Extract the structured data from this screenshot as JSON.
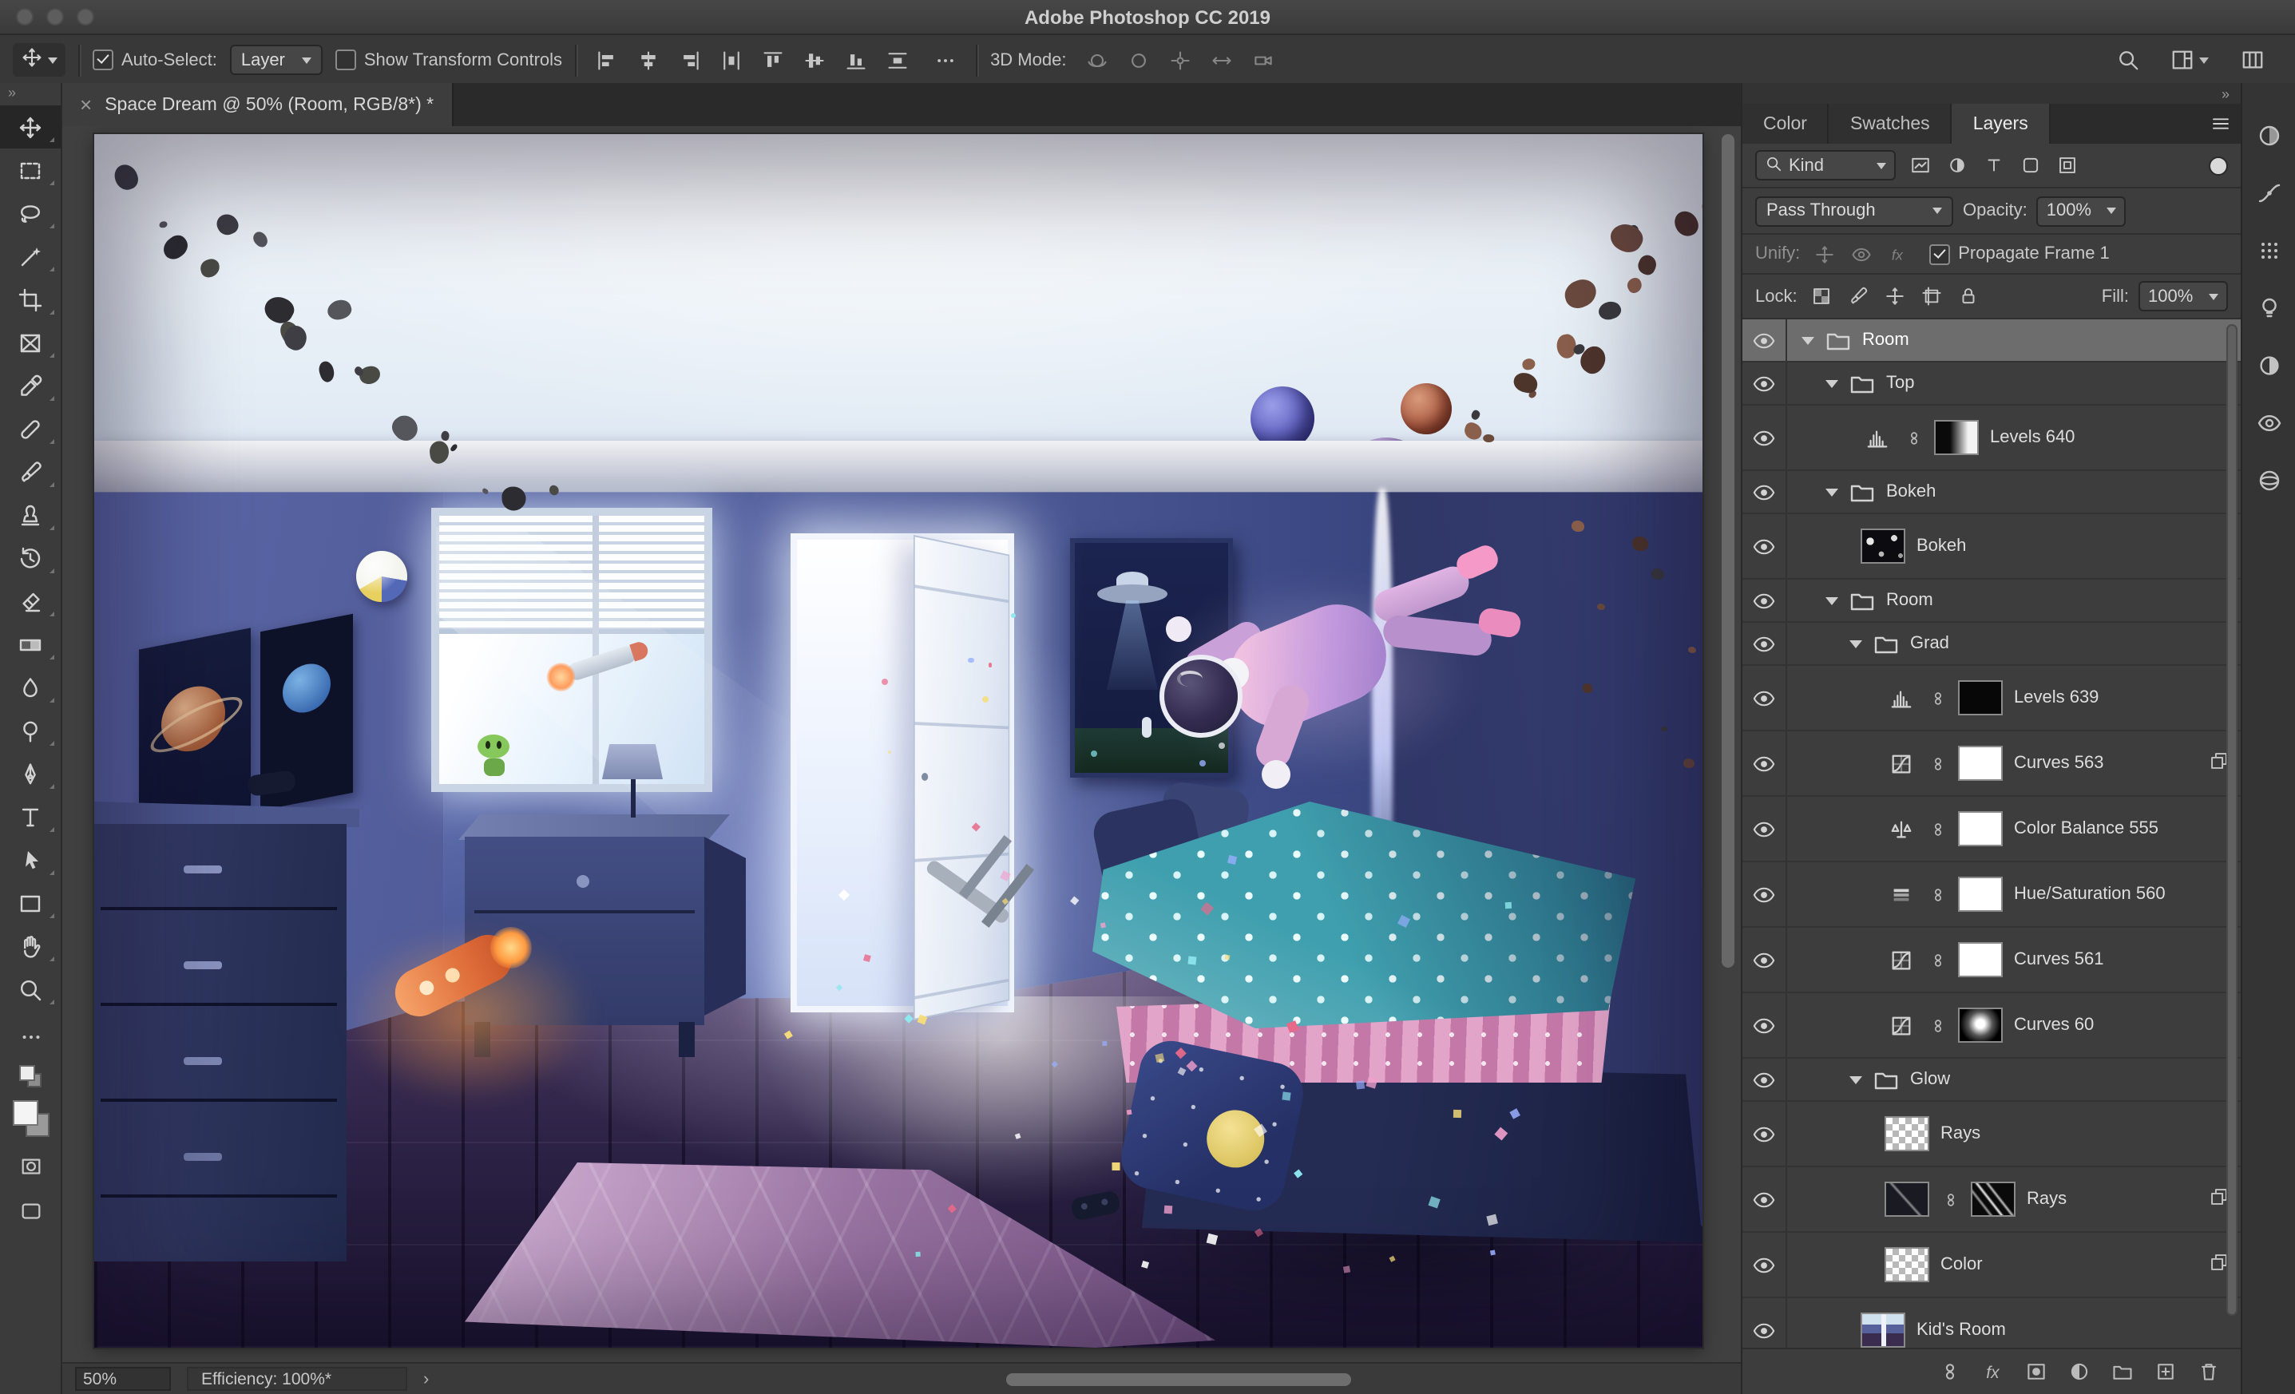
{
  "colors": {
    "panel_bg": "#3d3d3d",
    "selected_layer_row": "#6d6d6d",
    "pasteboard": "#404040",
    "canvas_sky": "#e3ecf5"
  },
  "titlebar": {
    "title": "Adobe Photoshop CC 2019"
  },
  "options_bar": {
    "tool_indicator": "move",
    "auto_select": {
      "label": "Auto-Select:",
      "checked": true
    },
    "mode_select": {
      "value": "Layer"
    },
    "show_transform": {
      "label": "Show Transform Controls",
      "checked": false
    },
    "align_icons": [
      "align-left-edges",
      "align-horizontal-centers",
      "align-right-edges",
      "distribute-horizontal",
      "align-top-edges",
      "align-vertical-centers",
      "align-bottom-edges",
      "distribute-vertical"
    ],
    "threed": {
      "label": "3D Mode:",
      "icons": [
        "3d-orbit",
        "3d-roll",
        "3d-pan",
        "3d-slide",
        "3d-camera"
      ]
    }
  },
  "doc_tab": {
    "close": "×",
    "title": "Space Dream @ 50% (Room, RGB/8*) *"
  },
  "tools_panel": {
    "collapse_glyph": "»"
  },
  "tools": [
    {
      "name": "move",
      "icon": "move",
      "label": "Move Tool"
    },
    {
      "name": "rectangular-marquee",
      "icon": "marquee",
      "label": "Rectangular Marquee Tool"
    },
    {
      "name": "lasso",
      "icon": "lasso",
      "label": "Lasso Tool"
    },
    {
      "name": "magic-wand",
      "icon": "wand",
      "label": "Magic Wand Tool"
    },
    {
      "name": "crop",
      "icon": "crop",
      "label": "Crop Tool"
    },
    {
      "name": "frame",
      "icon": "frame",
      "label": "Frame Tool"
    },
    {
      "name": "eyedropper",
      "icon": "eyedropper",
      "label": "Eyedropper Tool"
    },
    {
      "name": "spot-healing",
      "icon": "healing",
      "label": "Spot Healing Brush Tool"
    },
    {
      "name": "brush",
      "icon": "brush",
      "label": "Brush Tool"
    },
    {
      "name": "clone-stamp",
      "icon": "stamp",
      "label": "Clone Stamp Tool"
    },
    {
      "name": "history-brush",
      "icon": "history",
      "label": "History Brush Tool"
    },
    {
      "name": "eraser",
      "icon": "eraser",
      "label": "Eraser Tool"
    },
    {
      "name": "gradient",
      "icon": "gradient",
      "label": "Gradient Tool"
    },
    {
      "name": "blur",
      "icon": "blur",
      "label": "Blur Tool"
    },
    {
      "name": "dodge",
      "icon": "dodge",
      "label": "Dodge Tool"
    },
    {
      "name": "pen",
      "icon": "pen",
      "label": "Pen Tool"
    },
    {
      "name": "type",
      "icon": "type",
      "label": "Horizontal Type Tool"
    },
    {
      "name": "path-selection",
      "icon": "pathselect",
      "label": "Path Selection Tool"
    },
    {
      "name": "rectangle",
      "icon": "rect",
      "label": "Rectangle Tool"
    },
    {
      "name": "hand",
      "icon": "hand",
      "label": "Hand Tool"
    },
    {
      "name": "zoom",
      "icon": "zoom",
      "label": "Zoom Tool"
    }
  ],
  "status_bar": {
    "zoom": "50%",
    "efficiency": "Efficiency: 100%*",
    "chevron": "›"
  },
  "right_panel": {
    "collapse_glyph": "»",
    "tabs": [
      {
        "label": "Color",
        "active": false
      },
      {
        "label": "Swatches",
        "active": false
      },
      {
        "label": "Layers",
        "active": true
      }
    ],
    "filter_row": {
      "kind_label": "Kind",
      "filter_icons": [
        "filter-pixel-layers",
        "filter-adjustment-layers",
        "filter-type-layers",
        "filter-shape-layers",
        "filter-smart-objects"
      ]
    },
    "blend_row": {
      "blend_mode": "Pass Through",
      "opacity_label": "Opacity:",
      "opacity_value": "100%"
    },
    "unify_row": {
      "label": "Unify:",
      "icons": [
        "unify-position",
        "unify-visibility",
        "unify-style"
      ],
      "propagate": {
        "label": "Propagate Frame 1",
        "checked": true
      }
    },
    "lock_row": {
      "label": "Lock:",
      "icons": [
        "lock-transparency",
        "lock-image",
        "lock-position",
        "lock-artboard",
        "lock-all"
      ],
      "fill_label": "Fill:",
      "fill_value": "100%"
    },
    "layers": [
      {
        "name": "Room",
        "kind": "group",
        "indent": 0,
        "expanded": true,
        "selected": true,
        "visible": true
      },
      {
        "name": "Top",
        "kind": "group",
        "indent": 1,
        "expanded": true,
        "visible": true
      },
      {
        "name": "Levels 640",
        "kind": "adjustment",
        "adjustment": "levels",
        "indent": 2,
        "mask": "gradient",
        "visible": true
      },
      {
        "name": "Bokeh",
        "kind": "group",
        "indent": 1,
        "expanded": true,
        "visible": true
      },
      {
        "name": "Bokeh",
        "kind": "image",
        "thumb": "bokeh",
        "indent": 2,
        "visible": true
      },
      {
        "name": "Room",
        "kind": "group",
        "indent": 1,
        "expanded": true,
        "visible": true
      },
      {
        "name": "Grad",
        "kind": "group",
        "indent": 2,
        "expanded": true,
        "visible": true
      },
      {
        "name": "Levels 639",
        "kind": "adjustment",
        "adjustment": "levels",
        "indent": 3,
        "mask": "black",
        "visible": true
      },
      {
        "name": "Curves 563",
        "kind": "adjustment",
        "adjustment": "curves",
        "indent": 3,
        "mask": "white",
        "badge": true,
        "visible": true
      },
      {
        "name": "Color Balance 555",
        "kind": "adjustment",
        "adjustment": "color-balance",
        "indent": 3,
        "mask": "white",
        "visible": true
      },
      {
        "name": "Hue/Saturation 560",
        "kind": "adjustment",
        "adjustment": "hue-saturation",
        "indent": 3,
        "mask": "white",
        "visible": true
      },
      {
        "name": "Curves 561",
        "kind": "adjustment",
        "adjustment": "curves",
        "indent": 3,
        "mask": "white",
        "visible": true
      },
      {
        "name": "Curves 60",
        "kind": "adjustment",
        "adjustment": "curves",
        "indent": 3,
        "mask": "radial",
        "visible": true
      },
      {
        "name": "Glow",
        "kind": "group",
        "indent": 2,
        "expanded": true,
        "visible": true
      },
      {
        "name": "Rays",
        "kind": "image",
        "thumb": "checker",
        "indent": 3,
        "visible": true
      },
      {
        "name": "Rays",
        "kind": "image",
        "thumb": "rays-dark",
        "mask": "rays",
        "indent": 3,
        "badge": true,
        "visible": true
      },
      {
        "name": "Color",
        "kind": "image",
        "thumb": "checker",
        "indent": 3,
        "badge": true,
        "visible": true
      },
      {
        "name": "Kid's Room",
        "kind": "image",
        "thumb": "room",
        "indent": 2,
        "visible": true
      }
    ],
    "bottom_icons": [
      "link-layers",
      "layer-effects",
      "add-layer-mask",
      "new-adjustment-layer",
      "new-group",
      "new-layer",
      "delete-layer"
    ]
  },
  "dock_icons": [
    "color-panel",
    "paths-panel",
    "patterns-panel",
    "learn-panel",
    "adjustments-panel",
    "clone-source-panel",
    "libraries-panel"
  ]
}
